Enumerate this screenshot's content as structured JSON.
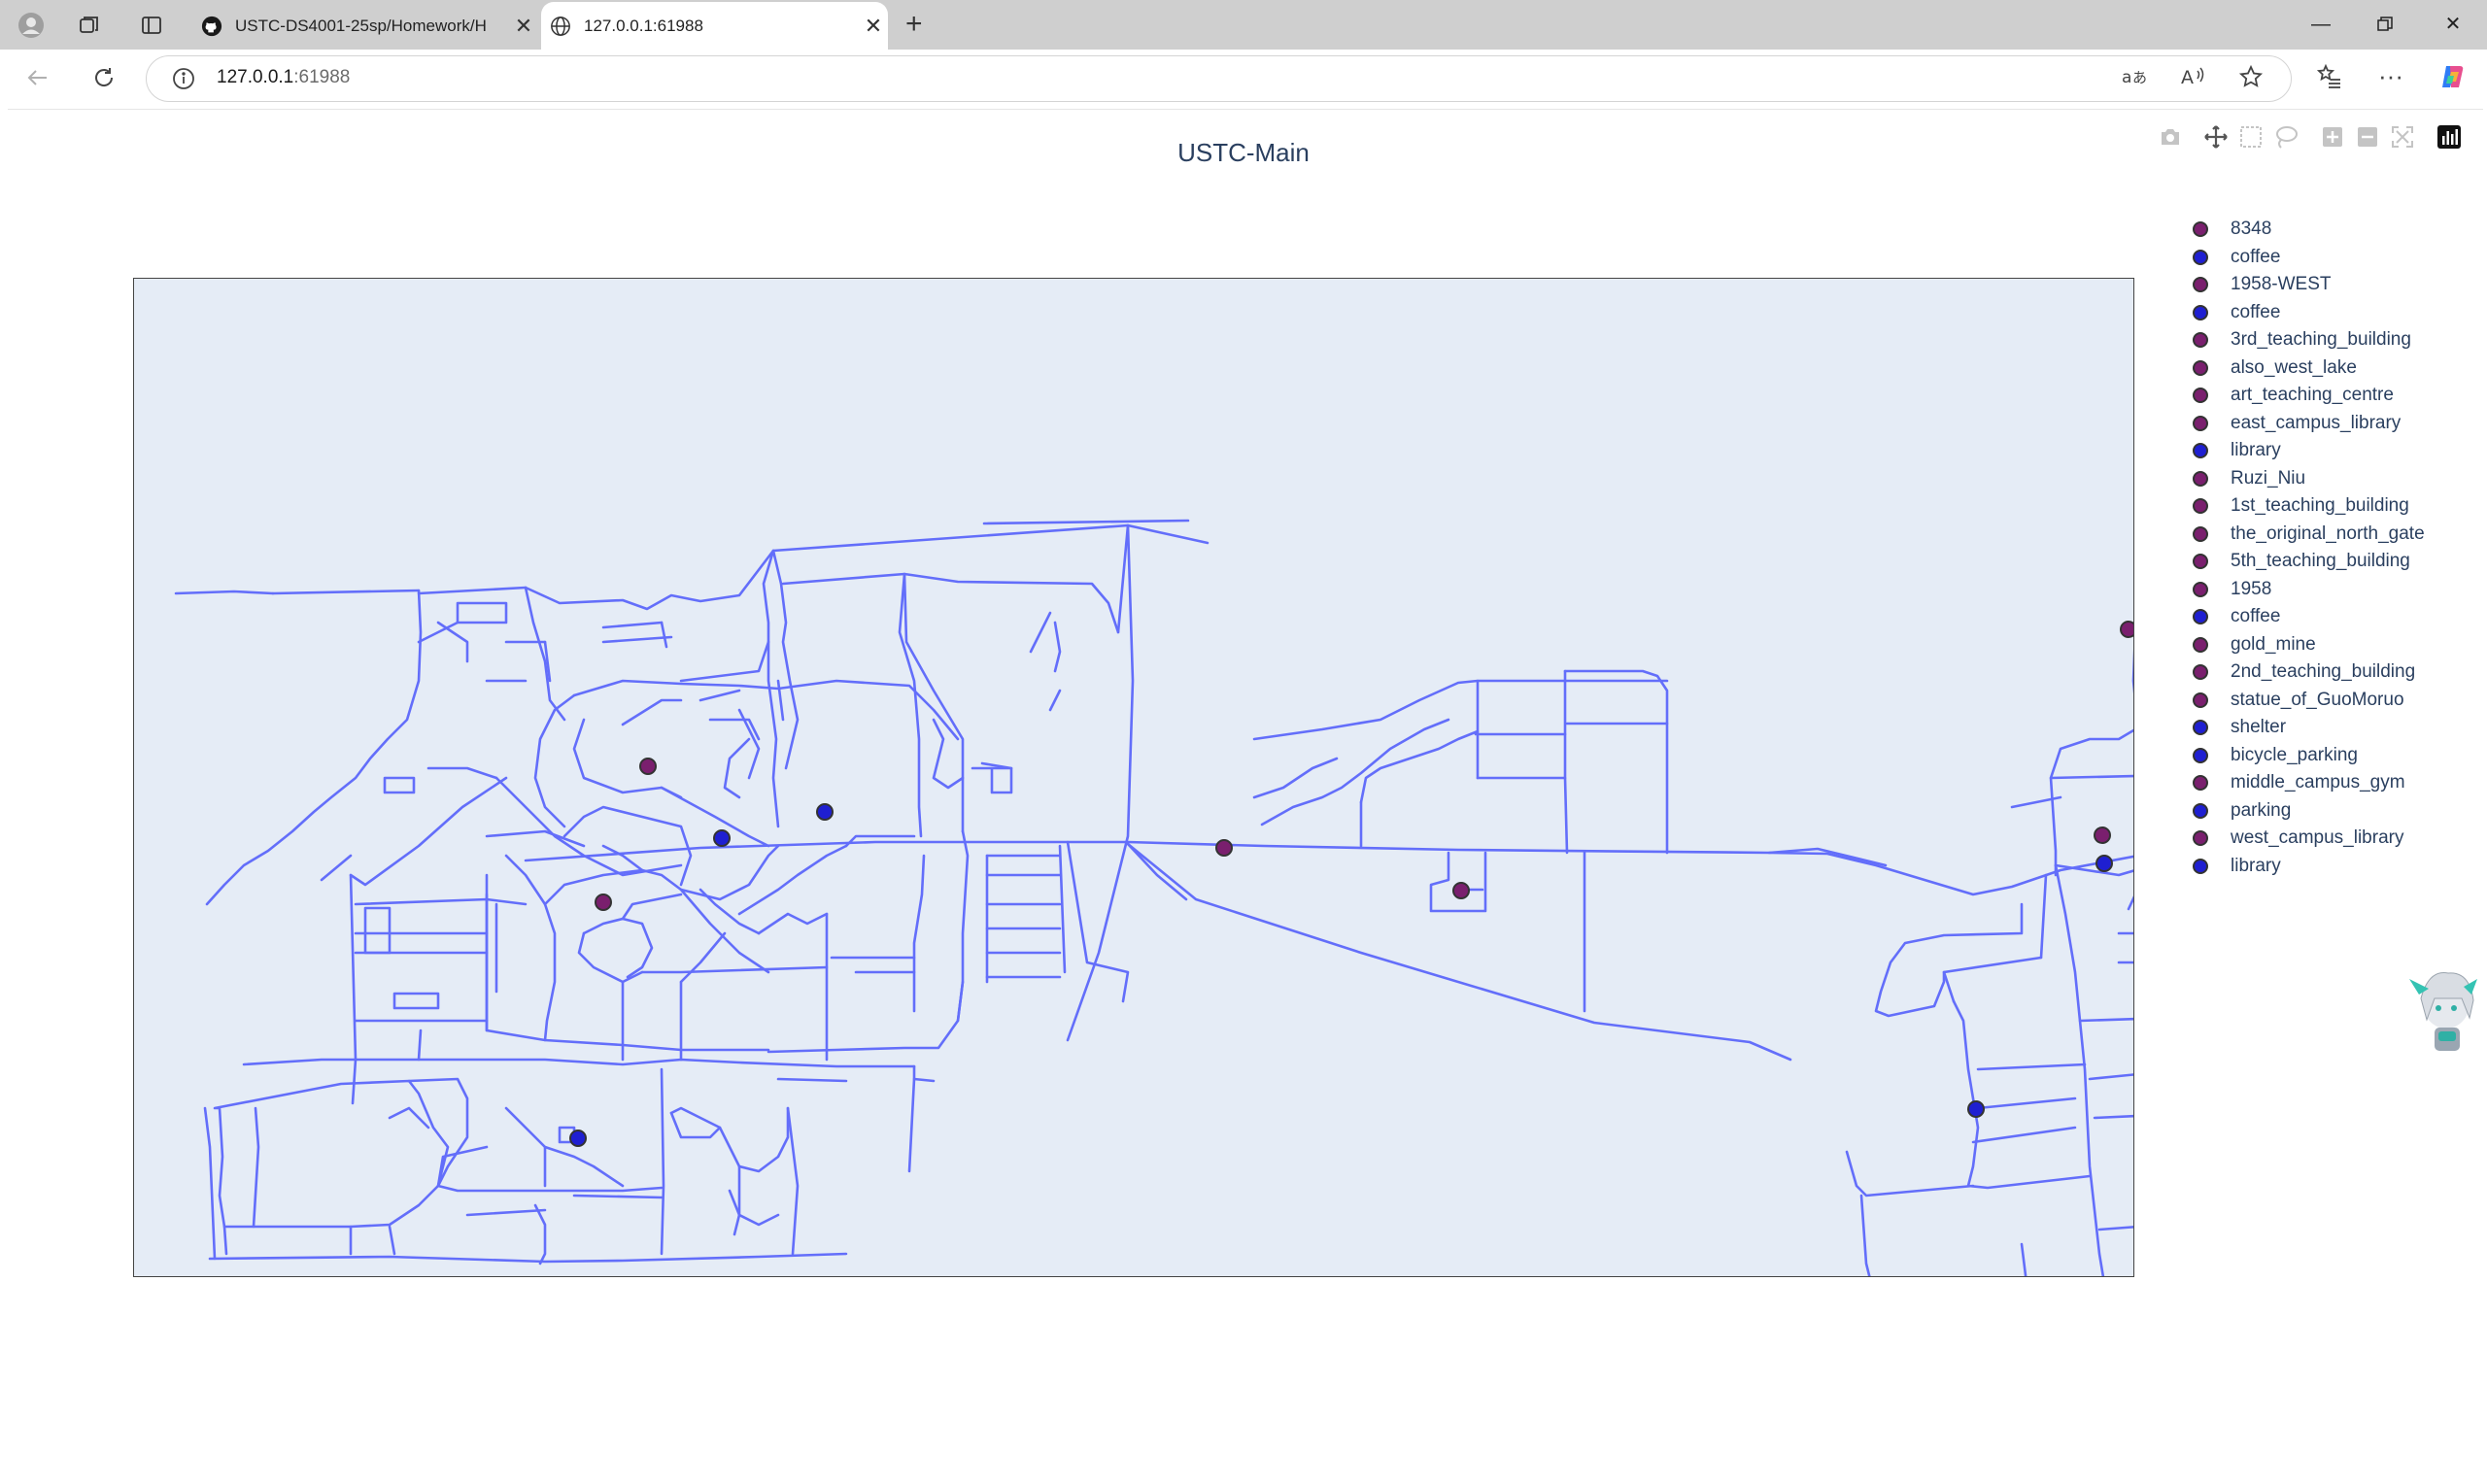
{
  "browser": {
    "tabs": [
      {
        "title": "USTC-DS4001-25sp/Homework/H",
        "icon": "github-icon",
        "active": false
      },
      {
        "title": "127.0.0.1:61988",
        "icon": "globe-icon",
        "active": true
      }
    ],
    "address": {
      "host": "127.0.0.1",
      "port": ":61988"
    },
    "toolbar_icons": [
      "back-icon",
      "refresh-icon",
      "info-icon",
      "translate-icon",
      "read-aloud-icon",
      "favorite-star-icon",
      "favorites-list-icon",
      "more-icon",
      "copilot-icon"
    ]
  },
  "plot": {
    "title": "USTC-Main",
    "modebar": [
      "camera-icon",
      "pan-icon",
      "box-select-icon",
      "lasso-icon",
      "zoom-in-icon",
      "zoom-out-icon",
      "autoscale-icon",
      "plotly-logo-icon"
    ],
    "colors": {
      "road": "#636efa",
      "purple": "#7a1f6e",
      "blue": "#1f1fd1",
      "bg": "#e5ecf6",
      "text": "#2a3f5f"
    }
  },
  "chart_data": {
    "type": "scatter",
    "title": "USTC-Main",
    "legend": [
      {
        "name": "8348",
        "color": "purple"
      },
      {
        "name": "coffee",
        "color": "blue"
      },
      {
        "name": "1958-WEST",
        "color": "purple"
      },
      {
        "name": "coffee",
        "color": "blue"
      },
      {
        "name": "3rd_teaching_building",
        "color": "purple"
      },
      {
        "name": "also_west_lake",
        "color": "purple"
      },
      {
        "name": "art_teaching_centre",
        "color": "purple"
      },
      {
        "name": "east_campus_library",
        "color": "purple"
      },
      {
        "name": "library",
        "color": "blue"
      },
      {
        "name": "Ruzi_Niu",
        "color": "purple"
      },
      {
        "name": "1st_teaching_building",
        "color": "purple"
      },
      {
        "name": "the_original_north_gate",
        "color": "purple"
      },
      {
        "name": "5th_teaching_building",
        "color": "purple"
      },
      {
        "name": "1958",
        "color": "purple"
      },
      {
        "name": "coffee",
        "color": "blue"
      },
      {
        "name": "gold_mine",
        "color": "purple"
      },
      {
        "name": "2nd_teaching_building",
        "color": "purple"
      },
      {
        "name": "statue_of_GuoMoruo",
        "color": "purple"
      },
      {
        "name": "shelter",
        "color": "blue"
      },
      {
        "name": "bicycle_parking",
        "color": "blue"
      },
      {
        "name": "middle_campus_gym",
        "color": "purple"
      },
      {
        "name": "parking",
        "color": "blue"
      },
      {
        "name": "west_campus_library",
        "color": "purple"
      },
      {
        "name": "library",
        "color": "blue"
      }
    ],
    "legend_position": "right",
    "grid": false
  }
}
